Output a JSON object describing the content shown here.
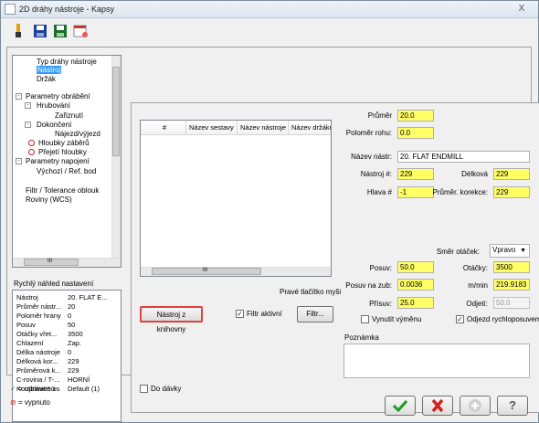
{
  "window": {
    "title": "2D dráhy nástroje - Kapsy",
    "close_label": "X"
  },
  "toolbar": {
    "icons": [
      "tool-icon",
      "save-icon",
      "save-all-icon",
      "calendar-icon"
    ]
  },
  "tree": {
    "items": [
      {
        "label": "Typ dráhy nástroje"
      },
      {
        "label": "Nástroj"
      },
      {
        "label": "Držák"
      },
      {
        "label": "Parametry obrábění"
      },
      {
        "label": "Hrubování"
      },
      {
        "label": "Zařiznutí"
      },
      {
        "label": "Dokončení"
      },
      {
        "label": "Nájezd/výjezd"
      },
      {
        "label": "Hloubky záběrů"
      },
      {
        "label": "Přejetí hloubky"
      },
      {
        "label": "Parametry napojení"
      },
      {
        "label": "Výchozí / Ref. bod"
      },
      {
        "label": "Filtr / Tolerance oblouk"
      },
      {
        "label": "Roviny (WCS)"
      }
    ],
    "hscroll_label": "III"
  },
  "preview": {
    "title": "Rychlý náhled nastavení",
    "rows": [
      {
        "name": "Nástroj",
        "value": "20. FLAT E..."
      },
      {
        "name": "Průměr nástr...",
        "value": "20"
      },
      {
        "name": "Poloměr hrany",
        "value": "0"
      },
      {
        "name": "Posuv",
        "value": "50"
      },
      {
        "name": "Otáčky vřet...",
        "value": "3500"
      },
      {
        "name": "Chlazení",
        "value": "Zap."
      },
      {
        "name": "Délka nástroje",
        "value": "0"
      },
      {
        "name": "Délková kor...",
        "value": "229"
      },
      {
        "name": "Průměrová k...",
        "value": "229"
      },
      {
        "name": "C-rovina / T-...",
        "value": "HORNÍ"
      },
      {
        "name": "Kombinace os",
        "value": "Default (1)"
      }
    ]
  },
  "legend": {
    "edited": "= upraveno",
    "disabled": "= vypnuto"
  },
  "grid": {
    "columns": [
      "#",
      "Název sestavy",
      "Název nástroje",
      "Název držáku"
    ],
    "hscroll_label": "III",
    "right_click_hint": "Pravé tlačítko myši"
  },
  "tool_library_button": "Nástroj z knihovny",
  "filter": {
    "checkbox_label": "Filtr aktivní",
    "button_label": "Filtr..."
  },
  "batch_label": "Do dávky",
  "params": {
    "diameter_label": "Průměr",
    "diameter_value": "20.0",
    "corner_radius_label": "Poloměr rohu:",
    "corner_radius_value": "0.0",
    "tool_name_label": "Název nástr:",
    "tool_name_value": "20. FLAT ENDMILL",
    "tool_num_label": "Nástroj #:",
    "tool_num_value": "229",
    "length_label": "Délková",
    "length_value": "229",
    "head_label": "Hlava #",
    "head_value": "-1",
    "dia_comp_label": "Průměr. korekce:",
    "dia_comp_value": "229",
    "spin_dir_label": "Směr otáček:",
    "spin_dir_value": "Vpravo",
    "feed_label": "Posuv:",
    "feed_value": "50.0",
    "rpm_label": "Otáčky:",
    "rpm_value": "3500",
    "feed_per_tooth_label": "Posuv na zub:",
    "feed_per_tooth_value": "0.0036",
    "m_min_label": "m/min",
    "m_min_value": "219.9183",
    "plunge_label": "Přísuv:",
    "plunge_value": "25.0",
    "retract_label": "Odjetí:",
    "retract_value": "50.0",
    "flood_label": "Vynutit výměnu",
    "rapid_retract_label": "Odjezd rychloposuvem",
    "note_label": "Poznámka"
  },
  "buttons": {
    "ok": "ok-icon",
    "cancel": "cancel-icon",
    "add": "add-icon",
    "help": "?"
  }
}
